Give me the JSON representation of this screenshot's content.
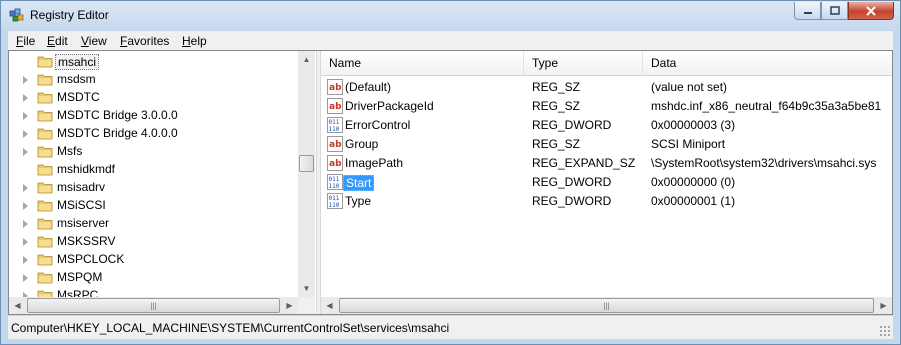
{
  "window": {
    "title": "Registry Editor"
  },
  "menu": [
    {
      "key": "F",
      "rest": "ile"
    },
    {
      "key": "E",
      "rest": "dit"
    },
    {
      "key": "V",
      "rest": "iew"
    },
    {
      "key": "F",
      "rest": "avorites"
    },
    {
      "key": "H",
      "rest": "elp"
    }
  ],
  "tree": {
    "items": [
      {
        "label": "msahci",
        "selected": true,
        "expandable": false
      },
      {
        "label": "msdsm",
        "expandable": true
      },
      {
        "label": "MSDTC",
        "expandable": true
      },
      {
        "label": "MSDTC Bridge 3.0.0.0",
        "expandable": true
      },
      {
        "label": "MSDTC Bridge 4.0.0.0",
        "expandable": true
      },
      {
        "label": "Msfs",
        "expandable": true
      },
      {
        "label": "mshidkmdf",
        "expandable": false
      },
      {
        "label": "msisadrv",
        "expandable": true
      },
      {
        "label": "MSiSCSI",
        "expandable": true
      },
      {
        "label": "msiserver",
        "expandable": true
      },
      {
        "label": "MSKSSRV",
        "expandable": true
      },
      {
        "label": "MSPCLOCK",
        "expandable": true
      },
      {
        "label": "MSPQM",
        "expandable": true
      },
      {
        "label": "MsRPC",
        "expandable": true
      }
    ]
  },
  "list": {
    "columns": [
      "Name",
      "Type",
      "Data"
    ],
    "rows": [
      {
        "icon": "string-value-icon",
        "name": "(Default)",
        "type": "REG_SZ",
        "data": "(value not set)"
      },
      {
        "icon": "string-value-icon",
        "name": "DriverPackageId",
        "type": "REG_SZ",
        "data": "mshdc.inf_x86_neutral_f64b9c35a3a5be81"
      },
      {
        "icon": "binary-value-icon",
        "name": "ErrorControl",
        "type": "REG_DWORD",
        "data": "0x00000003 (3)"
      },
      {
        "icon": "string-value-icon",
        "name": "Group",
        "type": "REG_SZ",
        "data": "SCSI Miniport"
      },
      {
        "icon": "string-value-icon",
        "name": "ImagePath",
        "type": "REG_EXPAND_SZ",
        "data": "\\SystemRoot\\system32\\drivers\\msahci.sys"
      },
      {
        "icon": "binary-value-icon",
        "name": "Start",
        "type": "REG_DWORD",
        "data": "0x00000000 (0)",
        "selected": true
      },
      {
        "icon": "binary-value-icon",
        "name": "Type",
        "type": "REG_DWORD",
        "data": "0x00000001 (1)"
      }
    ]
  },
  "status": {
    "path": "Computer\\HKEY_LOCAL_MACHINE\\SYSTEM\\CurrentControlSet\\services\\msahci"
  },
  "icons": {
    "app": "registry-editor-icon",
    "string": "ab",
    "binary": "011 110"
  },
  "colors": {
    "selection": "#3399ff",
    "title_bg": "#c6d8ee",
    "close": "#c5432e"
  }
}
